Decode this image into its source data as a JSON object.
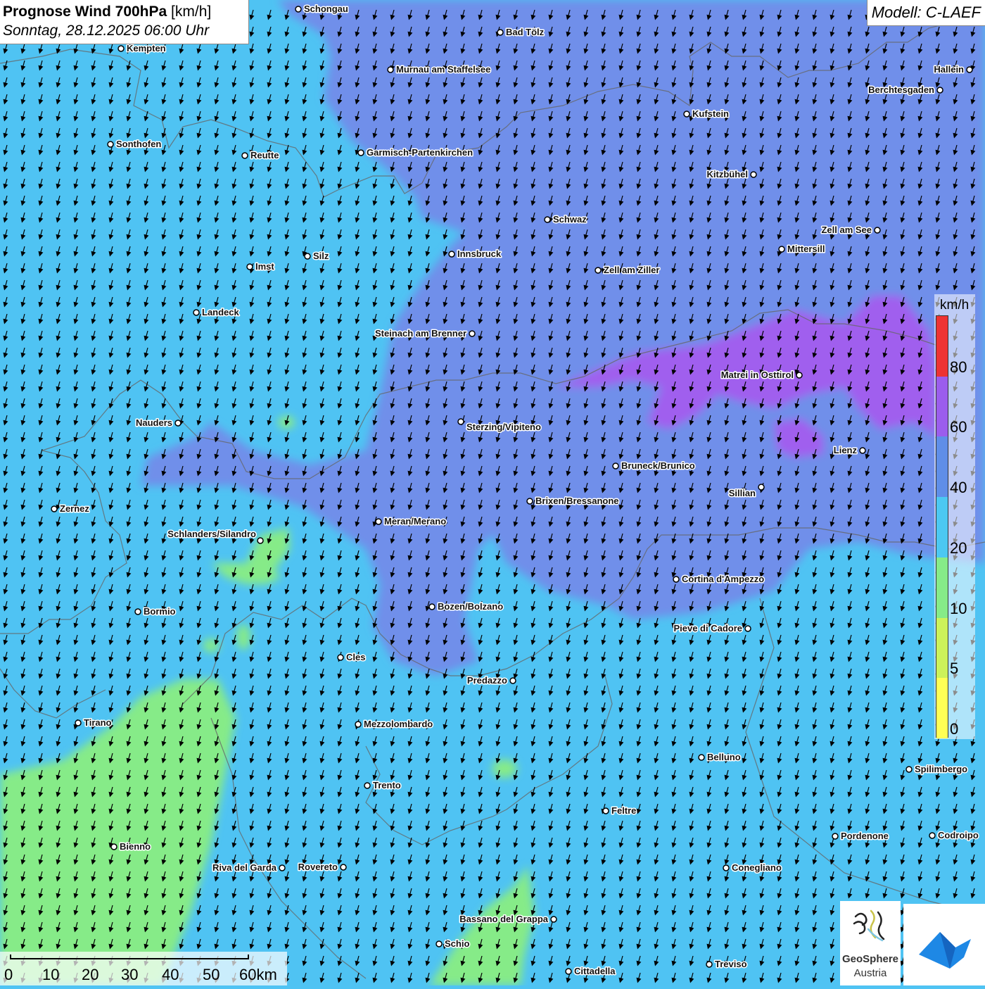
{
  "title": {
    "main": "Prognose Wind 700hPa",
    "unit": "[km/h]",
    "datetime": "Sonntag, 28.12.2025 06:00 Uhr"
  },
  "model": "Modell: C-LAEF",
  "legend": {
    "unit": "km/h",
    "ticks": [
      "0",
      "5",
      "10",
      "20",
      "40",
      "60",
      "80"
    ],
    "colors": [
      "#ffff55",
      "#ccf25a",
      "#86eb88",
      "#4cc8f2",
      "#5f8ee8",
      "#9b5ded",
      "#ee3333"
    ]
  },
  "scalebar": {
    "labels": [
      "0",
      "10",
      "20",
      "30",
      "40",
      "50",
      "60km"
    ]
  },
  "logos": {
    "geosphere_name": "GeoSphere",
    "geosphere_sub": "Austria"
  },
  "wind_arrows": {
    "direction": "from north-northeast",
    "icon": "arrow-icon"
  },
  "cities": [
    {
      "name": "Schongau"
    },
    {
      "name": "Bad Tölz"
    },
    {
      "name": "Kempten"
    },
    {
      "name": "Hallein"
    },
    {
      "name": "Murnau am Staffelsee"
    },
    {
      "name": "Berchtesgaden"
    },
    {
      "name": "Kufstein"
    },
    {
      "name": "Sonthofen"
    },
    {
      "name": "Reutte"
    },
    {
      "name": "Garmisch-Partenkirchen"
    },
    {
      "name": "Kitzbühel"
    },
    {
      "name": "Schwaz"
    },
    {
      "name": "Zell am See"
    },
    {
      "name": "Mittersill"
    },
    {
      "name": "Innsbruck"
    },
    {
      "name": "Silz"
    },
    {
      "name": "Imst"
    },
    {
      "name": "Zell am Ziller"
    },
    {
      "name": "Landeck"
    },
    {
      "name": "Steinach am Brenner"
    },
    {
      "name": "Matrei in Osttirol"
    },
    {
      "name": "Nauders"
    },
    {
      "name": "Sterzing/Vipiteno"
    },
    {
      "name": "Lienz"
    },
    {
      "name": "Bruneck/Brunico"
    },
    {
      "name": "Sillian"
    },
    {
      "name": "Zernez"
    },
    {
      "name": "Brixen/Bressanone"
    },
    {
      "name": "Meran/Merano"
    },
    {
      "name": "Schlanders/Silandro"
    },
    {
      "name": "Cortina d'Ampezzo"
    },
    {
      "name": "Bozen/Bolzano"
    },
    {
      "name": "Bormio"
    },
    {
      "name": "Pieve di Cadore"
    },
    {
      "name": "Cles"
    },
    {
      "name": "Predazzo"
    },
    {
      "name": "Tirano"
    },
    {
      "name": "Mezzolombardo"
    },
    {
      "name": "Belluno"
    },
    {
      "name": "Spilimbergo"
    },
    {
      "name": "Trento"
    },
    {
      "name": "Feltre"
    },
    {
      "name": "Pordenone"
    },
    {
      "name": "Codroipo"
    },
    {
      "name": "Bienno"
    },
    {
      "name": "Riva del Garda"
    },
    {
      "name": "Rovereto"
    },
    {
      "name": "Conegliano"
    },
    {
      "name": "Bassano del Grappa"
    },
    {
      "name": "Schio"
    },
    {
      "name": "Treviso"
    },
    {
      "name": "Cittadella"
    }
  ]
}
